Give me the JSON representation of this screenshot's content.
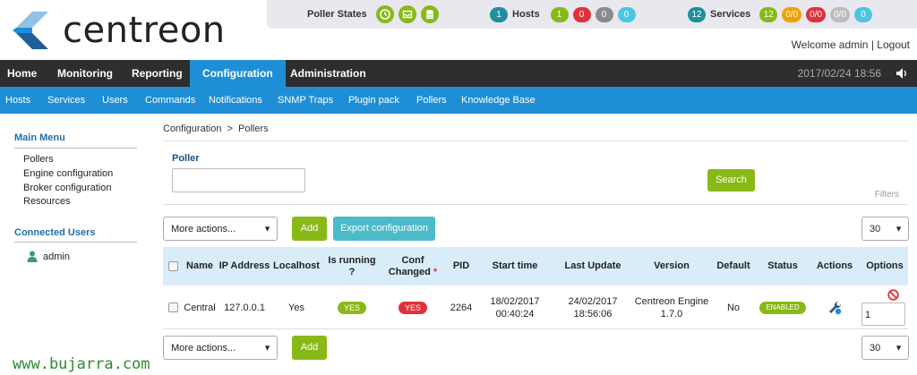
{
  "brand": {
    "name": "centreon"
  },
  "status_bar": {
    "poller_states_label": "Poller States",
    "hosts": {
      "count": "1",
      "label": "Hosts",
      "up": "1",
      "down": "0",
      "unreachable": "0",
      "pending": "0"
    },
    "services": {
      "count": "12",
      "label": "Services",
      "ok": "12",
      "warning": "0/0",
      "critical": "0/0",
      "unknown": "0/0",
      "pending": "0"
    }
  },
  "user": {
    "welcome": "Welcome admin",
    "logout": "Logout",
    "separator": "|"
  },
  "nav": {
    "items": [
      "Home",
      "Monitoring",
      "Reporting",
      "Configuration",
      "Administration"
    ],
    "active": "Configuration",
    "datetime": "2017/02/24 18:56"
  },
  "subnav": {
    "items": [
      "Hosts",
      "Services",
      "Users",
      "Commands",
      "Notifications",
      "SNMP Traps",
      "Plugin pack",
      "Pollers",
      "Knowledge Base"
    ]
  },
  "sidebar": {
    "main_menu_title": "Main Menu",
    "main_menu": [
      "Pollers",
      "Engine configuration",
      "Broker configuration",
      "Resources"
    ],
    "connected_users_title": "Connected Users",
    "connected_users": [
      "admin"
    ]
  },
  "breadcrumb": {
    "items": [
      "Configuration",
      "Pollers"
    ],
    "separator": ">"
  },
  "filter": {
    "poller_label": "Poller",
    "poller_value": "",
    "search_label": "Search",
    "filters_label": "Filters"
  },
  "toolbar": {
    "more_actions": "More actions...",
    "add": "Add",
    "export": "Export configuration",
    "page_size": "30"
  },
  "table": {
    "headers": {
      "name": "Name",
      "ip_address": "IP Address",
      "localhost": "Localhost",
      "is_running": "Is running ?",
      "conf_changed": "Conf Changed",
      "conf_changed_mark": "*",
      "pid": "PID",
      "start_time": "Start time",
      "last_update": "Last Update",
      "version": "Version",
      "default": "Default",
      "status": "Status",
      "actions": "Actions",
      "options": "Options"
    },
    "rows": [
      {
        "name": "Central",
        "ip_address": "127.0.0.1",
        "localhost": "Yes",
        "is_running": "YES",
        "conf_changed": "YES",
        "pid": "2264",
        "start_date": "18/02/2017",
        "start_clock": "00:40:24",
        "update_date": "24/02/2017",
        "update_clock": "18:56:06",
        "version_name": "Centreon Engine",
        "version_number": "1.7.0",
        "default": "No",
        "status": "ENABLED",
        "duplicate_count": "1"
      }
    ]
  },
  "watermark": "www.bujarra.com",
  "colors": {
    "accent": "#1e8fd6",
    "green": "#88b917",
    "red": "#e0303a",
    "grey": "#8a8a8a",
    "cyan": "#4bc6e0",
    "orange": "#f0a000",
    "teal": "#1f8e9e"
  }
}
